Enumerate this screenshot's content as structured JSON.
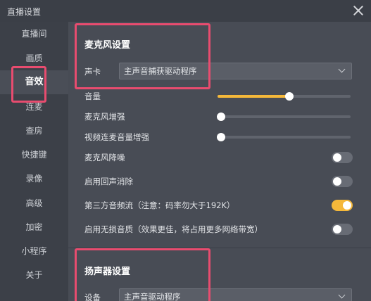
{
  "window": {
    "title": "直播设置"
  },
  "sidebar": {
    "items": [
      {
        "label": "直播间"
      },
      {
        "label": "画质"
      },
      {
        "label": "音效"
      },
      {
        "label": "连麦"
      },
      {
        "label": "查房"
      },
      {
        "label": "快捷键"
      },
      {
        "label": "录像"
      },
      {
        "label": "高级"
      },
      {
        "label": "加密"
      },
      {
        "label": "小程序"
      },
      {
        "label": "关于"
      }
    ],
    "active": "音效"
  },
  "mic_section": {
    "title": "麦克风设置",
    "sound_card_label": "声卡",
    "sound_card_value": "主声音捕获驱动程序",
    "volume_label": "音量",
    "volume_level": 0.54,
    "mic_boost_label": "麦克风增强",
    "mic_boost_level": 0.0,
    "video_link_boost_label": "视频连麦音量增强",
    "video_link_boost_level": 0.0,
    "noise_reduction_label": "麦克风降噪",
    "noise_reduction_on": false,
    "echo_cancel_label": "启用回声消除",
    "echo_cancel_on": false,
    "third_party_label": "第三方音频流（注意：码率勿大于192K）",
    "third_party_on": true,
    "lossless_label": "启用无损音质（效果更佳，将占用更多网络带宽）",
    "lossless_on": false
  },
  "speaker_section": {
    "title": "扬声器设置",
    "device_label": "设备",
    "device_value": "主声音驱动程序"
  },
  "colors": {
    "accent": "#f5b83a",
    "highlight": "#e84c6f"
  }
}
